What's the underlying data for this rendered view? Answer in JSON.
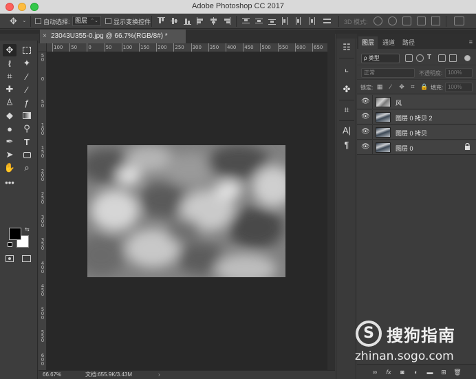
{
  "window": {
    "title": "Adobe Photoshop CC 2017"
  },
  "options_bar": {
    "auto_select_label": "自动选择:",
    "auto_select_value": "图层",
    "show_transform_label": "显示变换控件",
    "mode_3d_label": "3D 模式:"
  },
  "document": {
    "tab_title": "23043U355-0.jpg @ 66.7%(RGB/8#) *",
    "close_glyph": "×"
  },
  "rulers": {
    "horizontal": [
      "100",
      "50",
      "0",
      "50",
      "100",
      "150",
      "200",
      "250",
      "300",
      "350",
      "400",
      "450",
      "500",
      "550",
      "600",
      "650"
    ],
    "vertical": [
      "5\n0",
      "0",
      "5\n0",
      "1\n0\n0",
      "1\n5\n0",
      "2\n0\n0",
      "2\n5\n0",
      "3\n0\n0",
      "3\n5\n0",
      "4\n0\n0",
      "4\n5\n0",
      "5\n0\n0",
      "5\n5\n0",
      "6\n0\n0"
    ]
  },
  "status_bar": {
    "zoom": "66.67%",
    "doc_info": "文档:655.9K/3.43M",
    "arrow": "›"
  },
  "layers_panel": {
    "tabs": [
      "图层",
      "通道",
      "路径"
    ],
    "active_tab": 0,
    "kind_filter": "ρ 类型",
    "blend_mode": "正常",
    "opacity_label": "不透明度:",
    "opacity_value": "100%",
    "lock_label": "锁定:",
    "fill_label": "填充:",
    "fill_value": "100%",
    "layers": [
      {
        "name": "风",
        "visible": true,
        "locked": false
      },
      {
        "name": "图层 0 拷贝 2",
        "visible": true,
        "locked": false
      },
      {
        "name": "图层 0 拷贝",
        "visible": true,
        "locked": false
      },
      {
        "name": "图层 0",
        "visible": true,
        "locked": true
      }
    ]
  },
  "watermark": {
    "logo_letter": "S",
    "title": "搜狗指南",
    "url": "zhinan.sogo.com"
  },
  "colors": {
    "foreground": "#000000",
    "background": "#ffffff",
    "canvas_bg": "#282828",
    "panel_bg": "#3c3c3c"
  },
  "icons": {
    "tools": [
      "move-icon",
      "marquee-icon",
      "lasso-icon",
      "magic-wand-icon",
      "crop-icon",
      "eyedropper-icon",
      "healing-brush-icon",
      "brush-icon",
      "clone-stamp-icon",
      "history-brush-icon",
      "eraser-icon",
      "gradient-icon",
      "blur-icon",
      "dodge-icon",
      "pen-icon",
      "type-icon",
      "path-selection-icon",
      "rectangle-icon",
      "hand-icon",
      "zoom-icon",
      "more-tools-icon"
    ]
  }
}
